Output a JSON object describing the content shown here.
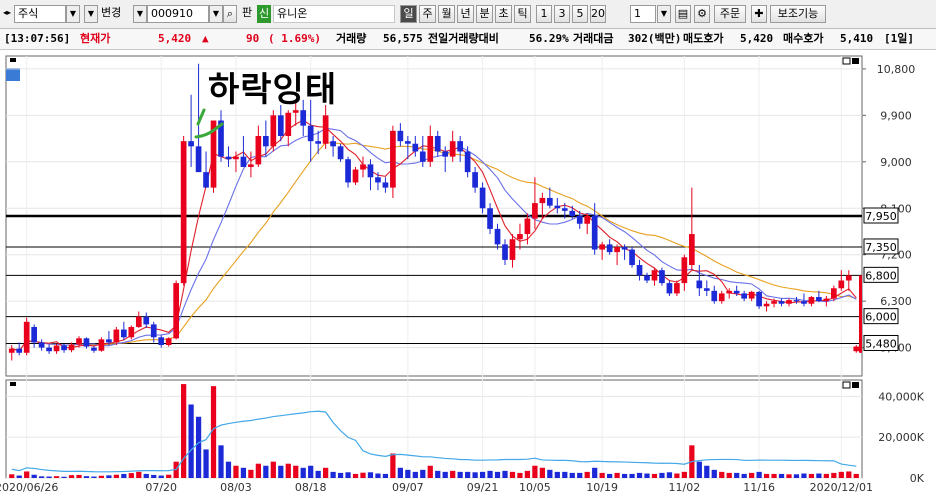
{
  "toolbar": {
    "market": "주식",
    "change_label": "변경",
    "code": "000910",
    "pan_label": "판",
    "shin_label": "신",
    "name": "유니온",
    "periods": [
      "일",
      "주",
      "월",
      "년",
      "분",
      "초",
      "틱"
    ],
    "active_period": "일",
    "minute_opts": [
      "1",
      "3",
      "5",
      "20"
    ],
    "count": "1",
    "order_label": "주문",
    "assist_label": "보조기능"
  },
  "quote": {
    "time": "[13:07:56]",
    "cur_label": "현재가",
    "price": "5,420",
    "arrow": "▲",
    "change": "90",
    "pct": "( 1.69%)",
    "vol_label": "거래량",
    "volume": "56,575",
    "prev_ratio_label": "전일거래량대비",
    "prev_ratio": "56.29%",
    "amount_label": "거래대금",
    "amount": "302(백만)",
    "ask_label": "매도호가",
    "ask": "5,420",
    "bid_label": "매수호가",
    "bid": "5,410",
    "frame": "[1일]"
  },
  "annotation": "하락잉태",
  "chart_data": {
    "type": "candlestick",
    "price_axis": {
      "ticks": [
        5400,
        6300,
        7200,
        8100,
        9000,
        9900,
        10800
      ],
      "labels": [
        "5,400",
        "6,300",
        "7,200",
        "8,100",
        "9,000",
        "9,900",
        "10,800"
      ],
      "ylim": [
        4850,
        11050
      ]
    },
    "volume_axis": {
      "ticks": [
        0,
        20000,
        40000
      ],
      "labels": [
        "0K",
        "20,000K",
        "40,000K"
      ],
      "ylim": [
        0,
        48000
      ]
    },
    "x_labels": [
      {
        "i": 2,
        "label": "2020/06/26"
      },
      {
        "i": 20,
        "label": "07/20"
      },
      {
        "i": 30,
        "label": "08/03"
      },
      {
        "i": 40,
        "label": "08/18"
      },
      {
        "i": 53,
        "label": "09/07"
      },
      {
        "i": 63,
        "label": "09/21"
      },
      {
        "i": 70,
        "label": "10/05"
      },
      {
        "i": 79,
        "label": "10/19"
      },
      {
        "i": 90,
        "label": "11/02"
      },
      {
        "i": 100,
        "label": "11/16"
      },
      {
        "i": 111,
        "label": "2020/12/01"
      }
    ],
    "hlines": [
      {
        "value": 7950,
        "label": "7,950",
        "bold": true
      },
      {
        "value": 7350,
        "label": "7,350"
      },
      {
        "value": 6800,
        "label": "6,800"
      },
      {
        "value": 6000,
        "label": "6,000"
      },
      {
        "value": 5480,
        "label": "5,480"
      }
    ],
    "current": {
      "value": 5420,
      "label": "5,420"
    },
    "candles": [
      [
        5300,
        5450,
        5150,
        5380,
        1800
      ],
      [
        5380,
        5500,
        5250,
        5300,
        1200
      ],
      [
        5300,
        5980,
        5250,
        5900,
        3200
      ],
      [
        5800,
        5850,
        5400,
        5500,
        1600
      ],
      [
        5500,
        5560,
        5340,
        5400,
        800
      ],
      [
        5400,
        5460,
        5280,
        5330,
        700
      ],
      [
        5330,
        5480,
        5280,
        5440,
        900
      ],
      [
        5440,
        5470,
        5300,
        5350,
        600
      ],
      [
        5350,
        5500,
        5310,
        5460,
        1400
      ],
      [
        5460,
        5620,
        5400,
        5580,
        1500
      ],
      [
        5580,
        5600,
        5380,
        5420,
        900
      ],
      [
        5400,
        5430,
        5300,
        5340,
        700
      ],
      [
        5340,
        5600,
        5320,
        5560,
        1100
      ],
      [
        5560,
        5720,
        5450,
        5500,
        1300
      ],
      [
        5500,
        5800,
        5450,
        5750,
        1600
      ],
      [
        5750,
        5900,
        5550,
        5600,
        2000
      ],
      [
        5600,
        5830,
        5560,
        5800,
        2400
      ],
      [
        5800,
        6100,
        5780,
        6000,
        3000
      ],
      [
        6000,
        6080,
        5780,
        5850,
        2000
      ],
      [
        5850,
        5900,
        5500,
        5600,
        1500
      ],
      [
        5600,
        5640,
        5400,
        5450,
        1200
      ],
      [
        5450,
        5600,
        5420,
        5580,
        1600
      ],
      [
        5580,
        6700,
        5560,
        6650,
        8000
      ],
      [
        6650,
        9500,
        6600,
        9400,
        46000
      ],
      [
        9400,
        10300,
        8900,
        9300,
        36000
      ],
      [
        9300,
        10900,
        9000,
        8800,
        30000
      ],
      [
        8800,
        9200,
        8500,
        8500,
        14000
      ],
      [
        8500,
        9500,
        8400,
        9800,
        45000
      ],
      [
        9800,
        10000,
        9000,
        9100,
        16000
      ],
      [
        9100,
        9300,
        8900,
        9050,
        8000
      ],
      [
        9050,
        9200,
        8800,
        9100,
        6000
      ],
      [
        9100,
        9500,
        8900,
        8900,
        5000
      ],
      [
        8900,
        9200,
        8700,
        8950,
        4000
      ],
      [
        8950,
        9700,
        8900,
        9500,
        7000
      ],
      [
        9500,
        9800,
        9100,
        9300,
        6000
      ],
      [
        9300,
        10000,
        9200,
        9900,
        8000
      ],
      [
        9900,
        10100,
        9400,
        9500,
        6000
      ],
      [
        9500,
        10000,
        9300,
        9950,
        7000
      ],
      [
        9950,
        10200,
        9700,
        10000,
        6000
      ],
      [
        10000,
        10200,
        9500,
        9700,
        5000
      ],
      [
        9700,
        10200,
        9000,
        9400,
        6000
      ],
      [
        9400,
        9600,
        9150,
        9350,
        3500
      ],
      [
        9350,
        10100,
        9250,
        9900,
        5000
      ],
      [
        9400,
        9500,
        9100,
        9300,
        3000
      ],
      [
        9300,
        9350,
        9000,
        9050,
        2500
      ],
      [
        9050,
        9100,
        8500,
        8600,
        2800
      ],
      [
        8600,
        8900,
        8550,
        8850,
        2000
      ],
      [
        8850,
        9100,
        8700,
        8950,
        2600
      ],
      [
        8950,
        9050,
        8450,
        8700,
        2800
      ],
      [
        8700,
        8800,
        8450,
        8600,
        2200
      ],
      [
        8600,
        8700,
        8400,
        8500,
        2000
      ],
      [
        8500,
        9700,
        8300,
        9600,
        12000
      ],
      [
        9600,
        9750,
        9300,
        9400,
        5000
      ],
      [
        9400,
        9500,
        9050,
        9350,
        4000
      ],
      [
        9350,
        9500,
        9100,
        9200,
        3000
      ],
      [
        9200,
        9500,
        8900,
        9000,
        4000
      ],
      [
        9000,
        9700,
        8900,
        9500,
        6000
      ],
      [
        9500,
        9600,
        9100,
        9200,
        3500
      ],
      [
        9200,
        9300,
        8800,
        9100,
        3000
      ],
      [
        9100,
        9600,
        9000,
        9400,
        3500
      ],
      [
        9400,
        9500,
        9000,
        9200,
        3000
      ],
      [
        9200,
        9300,
        8700,
        8800,
        3000
      ],
      [
        8800,
        8900,
        8400,
        8500,
        2800
      ],
      [
        8500,
        8600,
        8000,
        8100,
        3000
      ],
      [
        8100,
        8200,
        7600,
        7700,
        3500
      ],
      [
        7700,
        7800,
        7300,
        7400,
        3000
      ],
      [
        7400,
        7500,
        7000,
        7100,
        3500
      ],
      [
        7100,
        7600,
        6950,
        7500,
        3000
      ],
      [
        7500,
        7800,
        7300,
        7600,
        2500
      ],
      [
        7600,
        8000,
        7400,
        7900,
        3500
      ],
      [
        7900,
        8700,
        7700,
        8200,
        6000
      ],
      [
        8200,
        8400,
        7900,
        8300,
        5000
      ],
      [
        8300,
        8500,
        8100,
        8150,
        4000
      ],
      [
        8150,
        8300,
        8000,
        8100,
        3000
      ],
      [
        8100,
        8200,
        7900,
        8050,
        3000
      ],
      [
        8050,
        8150,
        7900,
        7950,
        2500
      ],
      [
        7950,
        8050,
        7700,
        7800,
        2500
      ],
      [
        7800,
        8000,
        7600,
        7950,
        3000
      ],
      [
        7950,
        8200,
        7200,
        7300,
        5000
      ],
      [
        7300,
        7450,
        7100,
        7400,
        2500
      ],
      [
        7400,
        7500,
        7200,
        7250,
        2000
      ],
      [
        7250,
        7400,
        7000,
        7350,
        2500
      ],
      [
        7350,
        7400,
        7100,
        7300,
        2000
      ],
      [
        7300,
        7350,
        6950,
        7000,
        2000
      ],
      [
        7000,
        7100,
        6700,
        6800,
        2500
      ],
      [
        6800,
        6850,
        6650,
        6700,
        2200
      ],
      [
        6700,
        6950,
        6600,
        6900,
        2000
      ],
      [
        6900,
        6950,
        6600,
        6650,
        2500
      ],
      [
        6650,
        6700,
        6400,
        6450,
        2800
      ],
      [
        6450,
        6700,
        6400,
        6650,
        2200
      ],
      [
        6650,
        7200,
        6500,
        7150,
        3000
      ],
      [
        7000,
        8500,
        6900,
        7600,
        16000
      ],
      [
        6700,
        7000,
        6400,
        6550,
        8000
      ],
      [
        6550,
        6700,
        6400,
        6500,
        6000
      ],
      [
        6500,
        6600,
        6250,
        6300,
        4000
      ],
      [
        6300,
        6500,
        6250,
        6450,
        3000
      ],
      [
        6450,
        6550,
        6350,
        6500,
        2500
      ],
      [
        6500,
        6600,
        6400,
        6450,
        2500
      ],
      [
        6450,
        6500,
        6300,
        6350,
        2000
      ],
      [
        6350,
        6500,
        6300,
        6480,
        2500
      ],
      [
        6480,
        6500,
        6150,
        6200,
        3000
      ],
      [
        6200,
        6300,
        6100,
        6250,
        2000
      ],
      [
        6250,
        6350,
        6180,
        6300,
        2000
      ],
      [
        6300,
        6350,
        6200,
        6250,
        2000
      ],
      [
        6250,
        6350,
        6200,
        6320,
        1800
      ],
      [
        6320,
        6380,
        6250,
        6300,
        1800
      ],
      [
        6300,
        6450,
        6200,
        6250,
        2200
      ],
      [
        6250,
        6400,
        6200,
        6380,
        2000
      ],
      [
        6380,
        6500,
        6280,
        6300,
        2200
      ],
      [
        6300,
        6400,
        6200,
        6350,
        2000
      ],
      [
        6350,
        6600,
        6300,
        6550,
        2500
      ],
      [
        6550,
        6900,
        6500,
        6700,
        3000
      ],
      [
        6700,
        6900,
        6500,
        6800,
        3200
      ],
      [
        5330,
        5450,
        5300,
        5420,
        2000
      ]
    ]
  }
}
